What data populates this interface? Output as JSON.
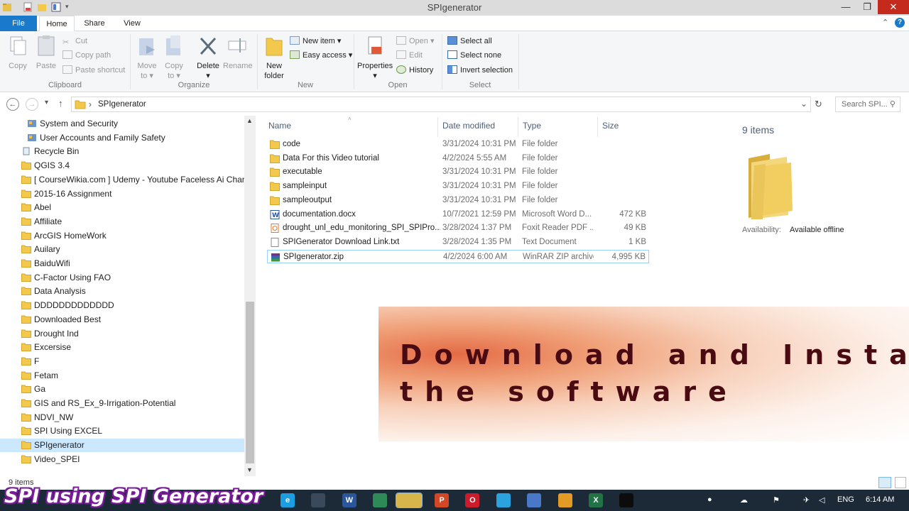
{
  "window": {
    "title": "SPIgenerator",
    "minimize_glyph": "—",
    "restore_glyph": "❐",
    "close_glyph": "✕"
  },
  "ribbon_tabs": {
    "file": "File",
    "home": "Home",
    "share": "Share",
    "view": "View"
  },
  "ribbon": {
    "clipboard": {
      "group": "Clipboard",
      "copy": "Copy",
      "paste": "Paste",
      "cut": "Cut",
      "copy_path": "Copy path",
      "paste_shortcut": "Paste shortcut"
    },
    "organize": {
      "group": "Organize",
      "move_to": "Move",
      "move_to_2": "to ▾",
      "copy_to": "Copy",
      "copy_to_2": "to ▾",
      "delete": "Delete",
      "delete_2": "▾",
      "rename": "Rename"
    },
    "new": {
      "group": "New",
      "new_folder": "New",
      "new_folder_2": "folder",
      "new_item": "New item ▾",
      "easy_access": "Easy access ▾"
    },
    "open": {
      "group": "Open",
      "properties": "Properties",
      "properties_2": "▾",
      "open": "Open ▾",
      "edit": "Edit",
      "history": "History"
    },
    "select": {
      "group": "Select",
      "select_all": "Select all",
      "select_none": "Select none",
      "invert": "Invert selection"
    }
  },
  "address": {
    "path": "SPIgenerator",
    "separator": "›",
    "search_placeholder": "Search SPI... ⚲",
    "back": "←",
    "forward": "→",
    "recent": "▾",
    "up": "↑",
    "dropdown": "⌄",
    "refresh": "↻"
  },
  "nav_pane": {
    "items": [
      {
        "label": "System and Security",
        "kind": "control"
      },
      {
        "label": "User Accounts and Family Safety",
        "kind": "control"
      },
      {
        "label": "Recycle Bin",
        "kind": "bin"
      },
      {
        "label": "QGIS 3.4",
        "kind": "folder"
      },
      {
        "label": "[ CourseWikia.com ] Udemy - Youtube Faceless Ai Channel \\",
        "kind": "folder"
      },
      {
        "label": "2015-16 Assignment",
        "kind": "folder"
      },
      {
        "label": "Abel",
        "kind": "folder"
      },
      {
        "label": "Affiliate",
        "kind": "folder"
      },
      {
        "label": "ArcGIS HomeWork",
        "kind": "folder"
      },
      {
        "label": "Auilary",
        "kind": "folder"
      },
      {
        "label": "BaiduWifi",
        "kind": "folder"
      },
      {
        "label": "C-Factor Using FAO",
        "kind": "folder"
      },
      {
        "label": "Data Analysis",
        "kind": "folder"
      },
      {
        "label": "DDDDDDDDDDDDD",
        "kind": "folder"
      },
      {
        "label": "Downloaded Best",
        "kind": "folder"
      },
      {
        "label": "Drought Ind",
        "kind": "folder"
      },
      {
        "label": "Excersise",
        "kind": "folder"
      },
      {
        "label": "F",
        "kind": "folder"
      },
      {
        "label": "Fetam",
        "kind": "folder"
      },
      {
        "label": "Ga",
        "kind": "folder"
      },
      {
        "label": "GIS and RS_Ex_9-Irrigation-Potential",
        "kind": "folder"
      },
      {
        "label": "NDVI_NW",
        "kind": "folder"
      },
      {
        "label": "SPI Using EXCEL",
        "kind": "folder"
      },
      {
        "label": "SPIgenerator",
        "kind": "folder",
        "selected": true
      },
      {
        "label": "Video_SPEI",
        "kind": "folder"
      }
    ]
  },
  "file_list": {
    "headers": {
      "name": "Name",
      "date": "Date modified",
      "type": "Type",
      "size": "Size"
    },
    "rows": [
      {
        "name": "code",
        "date": "3/31/2024 10:31 PM",
        "type": "File folder",
        "size": "",
        "icon": "folder"
      },
      {
        "name": "Data For this Video tutorial",
        "date": "4/2/2024 5:55 AM",
        "type": "File folder",
        "size": "",
        "icon": "folder"
      },
      {
        "name": "executable",
        "date": "3/31/2024 10:31 PM",
        "type": "File folder",
        "size": "",
        "icon": "folder"
      },
      {
        "name": "sampleinput",
        "date": "3/31/2024 10:31 PM",
        "type": "File folder",
        "size": "",
        "icon": "folder"
      },
      {
        "name": "sampleoutput",
        "date": "3/31/2024 10:31 PM",
        "type": "File folder",
        "size": "",
        "icon": "folder"
      },
      {
        "name": "documentation.docx",
        "date": "10/7/2021 12:59 PM",
        "type": "Microsoft Word D...",
        "size": "472 KB",
        "icon": "word"
      },
      {
        "name": "drought_unl_edu_monitoring_SPI_SPIPro...",
        "date": "3/28/2024 1:37 PM",
        "type": "Foxit Reader PDF ...",
        "size": "49 KB",
        "icon": "pdf"
      },
      {
        "name": "SPIGenerator Download Link.txt",
        "date": "3/28/2024 1:35 PM",
        "type": "Text Document",
        "size": "1 KB",
        "icon": "txt"
      },
      {
        "name": "SPIgenerator.zip",
        "date": "4/2/2024 6:00 AM",
        "type": "WinRAR ZIP archive",
        "size": "4,995 KB",
        "icon": "zip",
        "selected": true
      }
    ]
  },
  "details": {
    "count": "9 items",
    "availability_label": "Availability:",
    "availability_value": "Available offline"
  },
  "banner": {
    "line1": "Download and Install",
    "line2": "the software"
  },
  "status": {
    "count": "9 items"
  },
  "overlay": {
    "caption": "SPI using SPI Generator"
  },
  "taskbar": {
    "lang": "ENG",
    "time": "6:14 AM",
    "apps": [
      "edge-icon",
      "keyboard-icon",
      "word-icon",
      "tool-icon",
      "explorer-icon",
      "powerpoint-icon",
      "opera-icon",
      "telegram-icon",
      "bluetooth-icon",
      "chrome-canary-icon",
      "excel-icon",
      "terminal-icon"
    ]
  },
  "colors": {
    "accent": "#1979ca",
    "folder": "#f2c94c",
    "banner_text": "#4a0a12",
    "taskbar": "#1c2a38",
    "overlay_outline": "#7a1b9a"
  }
}
